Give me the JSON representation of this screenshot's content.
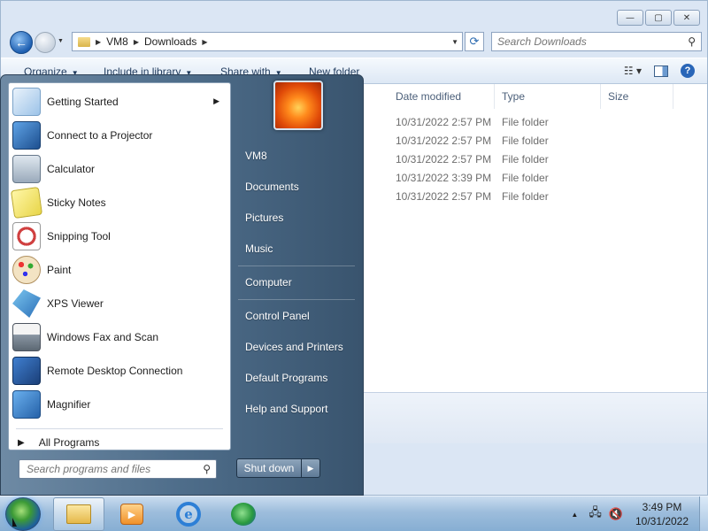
{
  "explorer": {
    "caption_buttons": {
      "minimize": "—",
      "maximize": "▢",
      "close": "✕"
    },
    "address": {
      "crumbs": [
        "VM8",
        "Downloads"
      ]
    },
    "search": {
      "placeholder": "Search Downloads"
    },
    "commands": [
      {
        "label": "Organize",
        "has_arrow": true
      },
      {
        "label": "Include in library",
        "has_arrow": true
      },
      {
        "label": "Share with",
        "has_arrow": true
      },
      {
        "label": "New folder",
        "has_arrow": false
      }
    ],
    "columns": [
      "Date modified",
      "Type",
      "Size"
    ],
    "rows": [
      {
        "date": "10/31/2022 2:57 PM",
        "type": "File folder"
      },
      {
        "date": "10/31/2022 2:57 PM",
        "type": "File folder"
      },
      {
        "date": "10/31/2022 2:57 PM",
        "type": "File folder"
      },
      {
        "date": "10/31/2022 3:39 PM",
        "type": "File folder"
      },
      {
        "date": "10/31/2022 2:57 PM",
        "type": "File folder"
      }
    ]
  },
  "start_menu": {
    "programs": [
      {
        "label": "Getting Started",
        "icon": "getting-started-icon",
        "has_submenu": true
      },
      {
        "label": "Connect to a Projector",
        "icon": "projector-icon",
        "has_submenu": false
      },
      {
        "label": "Calculator",
        "icon": "calculator-icon",
        "has_submenu": false
      },
      {
        "label": "Sticky Notes",
        "icon": "sticky-notes-icon",
        "has_submenu": false
      },
      {
        "label": "Snipping Tool",
        "icon": "snipping-tool-icon",
        "has_submenu": false
      },
      {
        "label": "Paint",
        "icon": "paint-icon",
        "has_submenu": false
      },
      {
        "label": "XPS Viewer",
        "icon": "xps-viewer-icon",
        "has_submenu": false
      },
      {
        "label": "Windows Fax and Scan",
        "icon": "fax-scan-icon",
        "has_submenu": false
      },
      {
        "label": "Remote Desktop Connection",
        "icon": "remote-desktop-icon",
        "has_submenu": false
      },
      {
        "label": "Magnifier",
        "icon": "magnifier-icon",
        "has_submenu": false
      }
    ],
    "all_programs": "All Programs",
    "search_placeholder": "Search programs and files",
    "right_links": [
      "VM8",
      "Documents",
      "Pictures",
      "Music",
      "Computer",
      "Control Panel",
      "Devices and Printers",
      "Default Programs",
      "Help and Support"
    ],
    "shutdown": "Shut down"
  },
  "taskbar": {
    "pinned": [
      "windows-explorer-icon",
      "media-player-icon",
      "internet-explorer-icon",
      "network-globe-icon"
    ],
    "clock": {
      "time": "3:49 PM",
      "date": "10/31/2022"
    }
  }
}
